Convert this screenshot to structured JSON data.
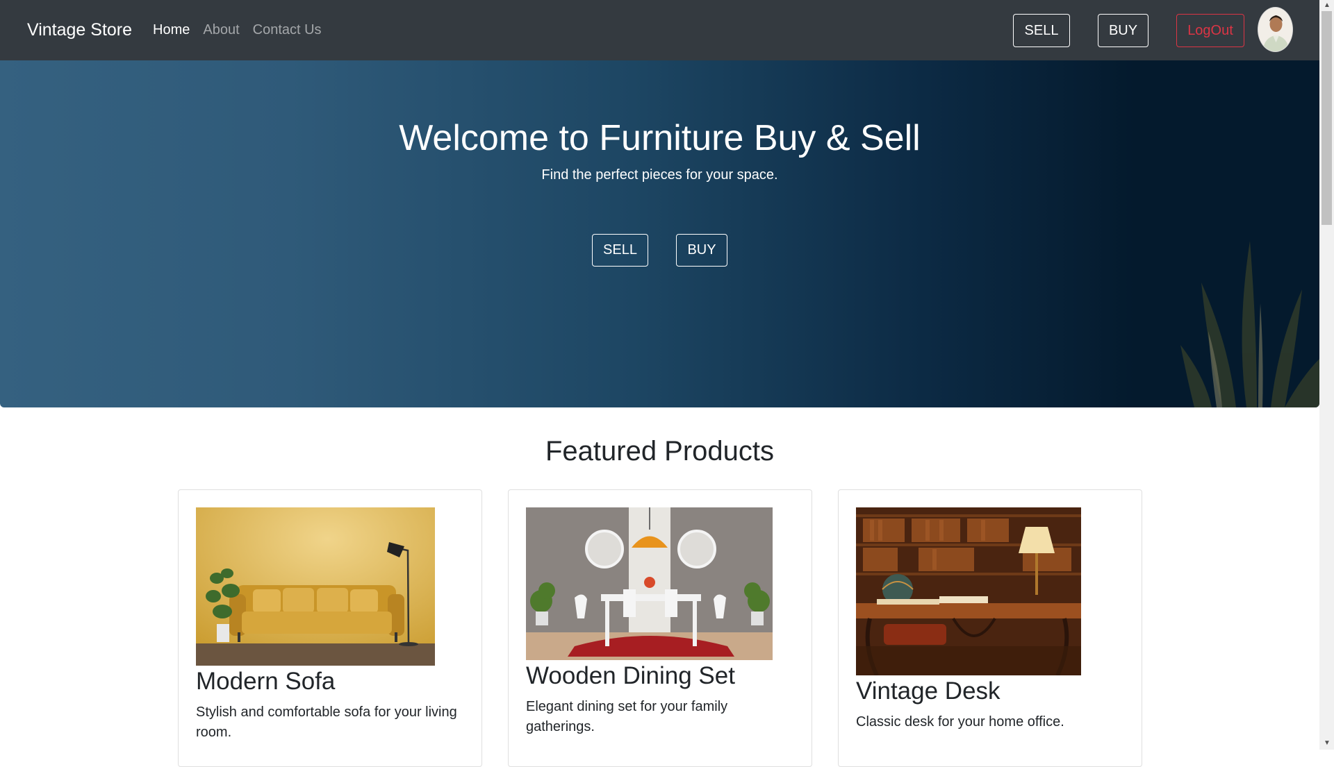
{
  "navbar": {
    "brand": "Vintage Store",
    "links": [
      "Home",
      "About",
      "Contact Us"
    ],
    "sell_label": "SELL",
    "buy_label": "BUY",
    "logout_label": "LogOut"
  },
  "hero": {
    "title": "Welcome to Furniture Buy & Sell",
    "subtitle": "Find the perfect pieces for your space.",
    "sell_label": "SELL",
    "buy_label": "BUY"
  },
  "featured": {
    "title": "Featured Products",
    "products": [
      {
        "name": "Modern Sofa",
        "description": "Stylish and comfortable sofa for your living room."
      },
      {
        "name": "Wooden Dining Set",
        "description": "Elegant dining set for your family gatherings."
      },
      {
        "name": "Vintage Desk",
        "description": "Classic desk for your home office."
      }
    ]
  },
  "colors": {
    "navbar_bg": "#343a40",
    "danger": "#dc3545",
    "hero_left": "#356180",
    "hero_right": "#041a2d"
  }
}
